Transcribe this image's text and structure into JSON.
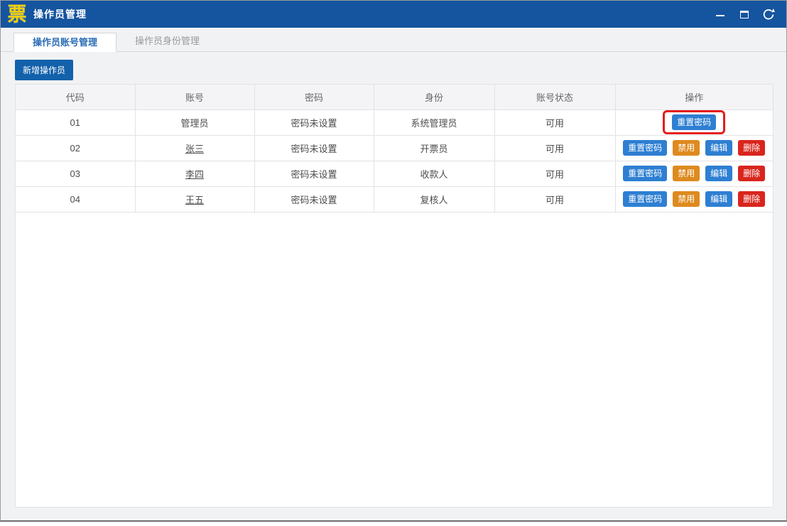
{
  "window": {
    "title": "操作员管理",
    "app_icon_glyph": "票",
    "controls": {
      "minimize": "minimize",
      "maximize": "maximize",
      "back": "back"
    }
  },
  "tabs": [
    {
      "label": "操作员账号管理",
      "active": true
    },
    {
      "label": "操作员身份管理",
      "active": false
    }
  ],
  "toolbar": {
    "add_operator_label": "新增操作员"
  },
  "table": {
    "columns": [
      "代码",
      "账号",
      "密码",
      "身份",
      "账号状态",
      "操作"
    ],
    "action_labels": {
      "reset": "重置密码",
      "disable": "禁用",
      "edit": "编辑",
      "delete": "删除"
    },
    "rows": [
      {
        "code": "01",
        "account": "管理员",
        "account_link": false,
        "password": "密码未设置",
        "identity": "系统管理员",
        "status": "可用",
        "actions": [
          "reset"
        ],
        "highlight_reset": true
      },
      {
        "code": "02",
        "account": "张三",
        "account_link": true,
        "password": "密码未设置",
        "identity": "开票员",
        "status": "可用",
        "actions": [
          "reset",
          "disable",
          "edit",
          "delete"
        ],
        "highlight_reset": false
      },
      {
        "code": "03",
        "account": "李四",
        "account_link": true,
        "password": "密码未设置",
        "identity": "收款人",
        "status": "可用",
        "actions": [
          "reset",
          "disable",
          "edit",
          "delete"
        ],
        "highlight_reset": false
      },
      {
        "code": "04",
        "account": "王五",
        "account_link": true,
        "password": "密码未设置",
        "identity": "复核人",
        "status": "可用",
        "actions": [
          "reset",
          "disable",
          "edit",
          "delete"
        ],
        "highlight_reset": false
      }
    ]
  },
  "colors": {
    "titlebar_blue": "#15549e",
    "icon_yellow": "#f5d000",
    "accent_blue": "#1261ab",
    "button_blue": "#2e7fd2",
    "button_orange": "#de8a1f",
    "button_red": "#d9251d",
    "highlight_red": "#e51c1c",
    "tab_active_text": "#2a6db5"
  }
}
